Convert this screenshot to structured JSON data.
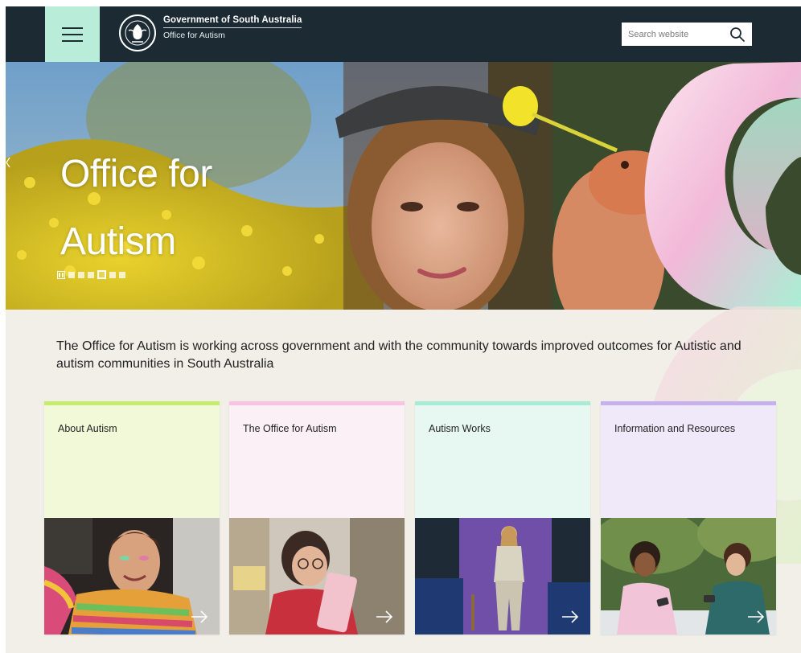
{
  "header": {
    "government": "Government of South Australia",
    "office": "Office for Autism",
    "search_placeholder": "Search website",
    "menu_icon": "hamburger-menu-icon",
    "search_icon": "search-icon",
    "logo_icon": "government-crest-icon"
  },
  "hero": {
    "title_line1": "Office for",
    "title_line2": "Autism",
    "carousel": {
      "slides": 7,
      "active_index": 4
    }
  },
  "intro": "The Office for Autism is working across government and with the community towards improved outcomes for Autistic and autism communities in South Australia",
  "cards": [
    {
      "label": "About Autism",
      "accent": "#c5ec6e",
      "bg": "#f1f9d9"
    },
    {
      "label": "The Office for Autism",
      "accent": "#f9c3e1",
      "bg": "#fcf0f7"
    },
    {
      "label": "Autism Works",
      "accent": "#a8ecd6",
      "bg": "#e6f8f1"
    },
    {
      "label": "Information and Resources",
      "accent": "#c6b1ee",
      "bg": "#efe9fa"
    }
  ],
  "colors": {
    "header_bg": "#1b2a33",
    "menu_bg": "#b9ecd9",
    "page_bg": "#f1efe8"
  }
}
